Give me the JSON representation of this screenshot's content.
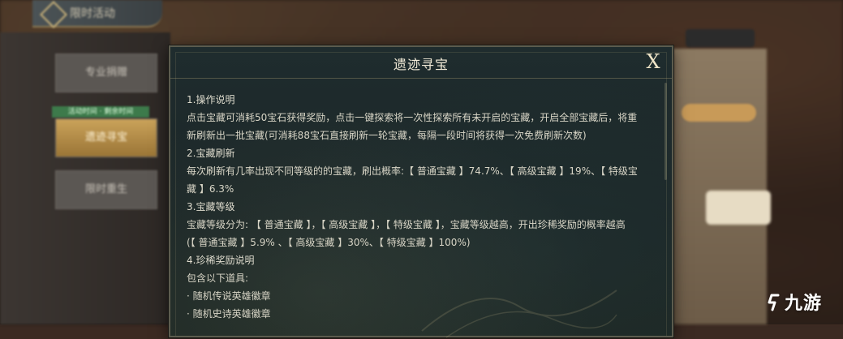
{
  "sidebar": {
    "header_title": "限时活动",
    "buttons": [
      {
        "label": "专业捐赠"
      },
      {
        "label": "遗迹寻宝"
      },
      {
        "label": "限时重生"
      }
    ],
    "event_tag": "活动时间 · 剩余时间"
  },
  "dialog": {
    "title": "遗迹寻宝",
    "close_label": "X",
    "lines": [
      "1.操作说明",
      "点击宝藏可消耗50宝石获得奖励，点击一键探索将一次性探索所有未开启的宝藏，开启全部宝藏后，将重",
      "新刷新出一批宝藏(可消耗88宝石直接刷新一轮宝藏，每隔一段时间将获得一次免费刷新次数)",
      "2.宝藏刷新",
      "每次刷新有几率出现不同等级的的宝藏，刷出概率:【 普通宝藏 】74.7%、【 高级宝藏 】19%、【 特级宝",
      "藏 】6.3%",
      "3.宝藏等级",
      "宝藏等级分为: 【 普通宝藏 】，【 高级宝藏 】，【 特级宝藏 】，宝藏等级越高，开出珍稀奖励的概率越高",
      "(【 普通宝藏 】5.9% 、【 高级宝藏 】30%、【 特级宝藏 】100%)",
      "4.珍稀奖励说明",
      "包含以下道具:",
      "· 随机传说英雄徽章",
      "· 随机史诗英雄徽章"
    ]
  },
  "watermark": {
    "text": "九游"
  },
  "colors": {
    "dialog_bg": "#1f2c2e",
    "text": "#d8d5c6",
    "active_tab": "#caa25a"
  }
}
